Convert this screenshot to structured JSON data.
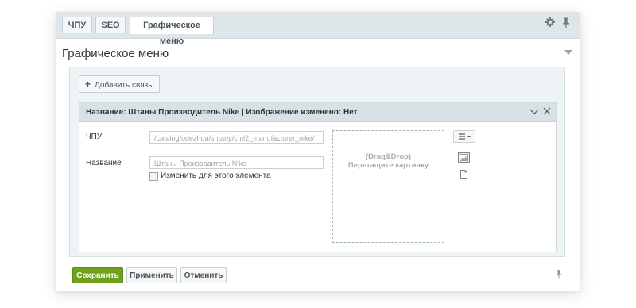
{
  "tabs": [
    {
      "label": "ЧПУ"
    },
    {
      "label": "SEO"
    },
    {
      "label": "Графическое меню",
      "active": true
    }
  ],
  "tab_icons": {
    "settings": "gear-icon",
    "pin": "pin-icon"
  },
  "section": {
    "title": "Графическое меню",
    "add_link_label": "Добавить связь"
  },
  "item": {
    "header": "Название: Штаны Производитель Nike | Изображение изменено: Нет",
    "chpu_label": "ЧПУ",
    "chpu_value": "/catalog/odezhda/shtany/cml2_manufacturer_nike/",
    "name_label": "Название",
    "name_value": "Штаны Производитель Nike",
    "checkbox_label": "Изменить для этого элемента",
    "checkbox_checked": false,
    "drop_line1": "(Drag&Drop)",
    "drop_line2": "Перетащите картинку"
  },
  "footer": {
    "save_label": "Сохранить",
    "apply_label": "Применить",
    "cancel_label": "Отменить"
  },
  "colors": {
    "save_button": "#6fa11d",
    "tabbar": "#dfe6e9",
    "panel": "#eef3f5",
    "item_header": "#d7e1e6"
  }
}
